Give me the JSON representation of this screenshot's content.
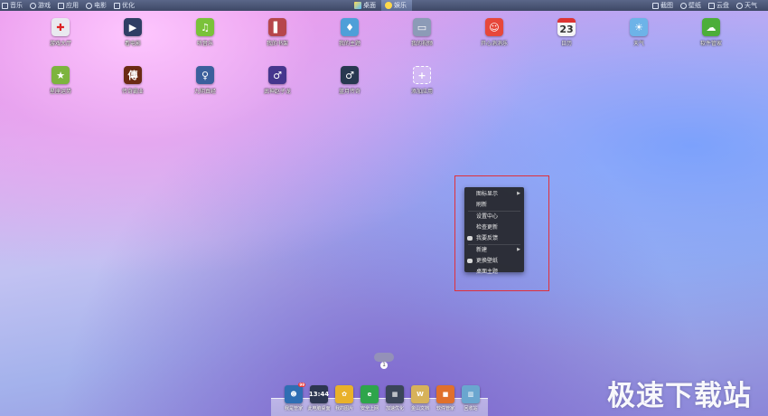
{
  "topbar": {
    "left_items": [
      {
        "label": "音乐",
        "icon": "music-icon"
      },
      {
        "label": "游戏",
        "icon": "gamepad-icon"
      },
      {
        "label": "应用",
        "icon": "app-icon"
      },
      {
        "label": "电影",
        "icon": "film-icon"
      },
      {
        "label": "优化",
        "icon": "wrench-icon"
      }
    ],
    "tabs": [
      {
        "label": "桌面",
        "icon": "windows-icon",
        "active": false
      },
      {
        "label": "娱乐",
        "icon": "star-icon",
        "active": true
      }
    ],
    "right_items": [
      {
        "label": "截图",
        "icon": "scissors-icon"
      },
      {
        "label": "壁纸",
        "icon": "shirt-icon"
      },
      {
        "label": "云盘",
        "icon": "cloud-icon"
      },
      {
        "label": "天气",
        "icon": "clock-icon"
      }
    ]
  },
  "desktop": {
    "row1": [
      {
        "label": "游戏大厅",
        "icon": "joystick-icon",
        "color": "#e9e9ef",
        "glyph": "✚"
      },
      {
        "label": "看电影",
        "icon": "clapperboard-icon",
        "color": "#2f3e64",
        "glyph": "▶"
      },
      {
        "label": "听音乐",
        "icon": "music-note-icon",
        "color": "#7ac23a",
        "glyph": "♫"
      },
      {
        "label": "我的书架",
        "icon": "books-icon",
        "color": "#b6464b",
        "glyph": "▌"
      },
      {
        "label": "我的主题",
        "icon": "shirt-icon",
        "color": "#4f9fd8",
        "glyph": "♦"
      },
      {
        "label": "我的视频",
        "icon": "tv-icon",
        "color": "#8c9bb7",
        "glyph": "▭"
      },
      {
        "label": "开心消消乐",
        "icon": "game-cartoon-icon",
        "color": "#e7473a",
        "glyph": "☺"
      },
      {
        "label": "日历",
        "icon": "calendar-icon",
        "color": "#f5f5f5",
        "glyph": "23"
      },
      {
        "label": "天气",
        "icon": "weather-icon",
        "color": "#6db3e8",
        "glyph": "☀"
      },
      {
        "label": "软件管家",
        "icon": "bag-icon",
        "color": "#4cae39",
        "glyph": "☁"
      }
    ],
    "row2": [
      {
        "label": "星座运势",
        "icon": "star-icon",
        "color": "#7db43e",
        "glyph": "★"
      },
      {
        "label": "传奇霸业",
        "icon": "game-legend-icon",
        "color": "#6b2a14",
        "glyph": "傳"
      },
      {
        "label": "九阴真经",
        "icon": "game-portrait-icon",
        "color": "#3b5f9c",
        "glyph": "♀"
      },
      {
        "label": "武神赵子龙",
        "icon": "game-warrior-icon",
        "color": "#45368d",
        "glyph": "♂"
      },
      {
        "label": "蓝月传奇",
        "icon": "game-hero-icon",
        "color": "#283850",
        "glyph": "♂"
      },
      {
        "label": "添加应用",
        "icon": "add-icon",
        "color": "#c8c8e0",
        "glyph": "+"
      }
    ]
  },
  "context_menu": {
    "items": [
      {
        "label": "图标显示",
        "submenu": true,
        "icon": ""
      },
      {
        "label": "刷新",
        "submenu": false,
        "icon": ""
      },
      {
        "sep": true
      },
      {
        "label": "设置中心",
        "submenu": false,
        "icon": ""
      },
      {
        "label": "检查更新",
        "submenu": false,
        "icon": ""
      },
      {
        "label": "我要反馈",
        "submenu": false,
        "icon": "chat-icon"
      },
      {
        "sep": true
      },
      {
        "label": "新建",
        "submenu": true,
        "icon": ""
      },
      {
        "label": "更换壁纸",
        "submenu": false,
        "icon": "shirt-icon"
      },
      {
        "label": "桌面主题",
        "submenu": false,
        "icon": ""
      }
    ]
  },
  "pager": {
    "current": "1"
  },
  "dock": {
    "items": [
      {
        "label": "我是管家",
        "icon": "user-icon",
        "color": "#2f6eb3",
        "glyph": "☻",
        "badge": "99"
      },
      {
        "label": "此电脑桌面",
        "icon": "clock-screen-icon",
        "color": "#2c3650",
        "glyph": "13:44",
        "badge": ""
      },
      {
        "label": "我的图片",
        "icon": "photos-icon",
        "color": "#e9b12a",
        "glyph": "✿",
        "badge": ""
      },
      {
        "label": "安全上网",
        "icon": "browser-icon",
        "color": "#2ea54b",
        "glyph": "e",
        "badge": ""
      },
      {
        "label": "加速优化",
        "icon": "calculator-icon",
        "color": "#3a4558",
        "glyph": "▦",
        "badge": ""
      },
      {
        "label": "金山文档",
        "icon": "document-icon",
        "color": "#d7b25a",
        "glyph": "W",
        "badge": ""
      },
      {
        "label": "软件管家",
        "icon": "cube-icon",
        "color": "#e0702c",
        "glyph": "■",
        "badge": ""
      },
      {
        "label": "回收站",
        "icon": "trash-icon",
        "color": "#6aa6cf",
        "glyph": "▥",
        "badge": ""
      }
    ]
  },
  "watermark": {
    "text": "极速下载站"
  }
}
